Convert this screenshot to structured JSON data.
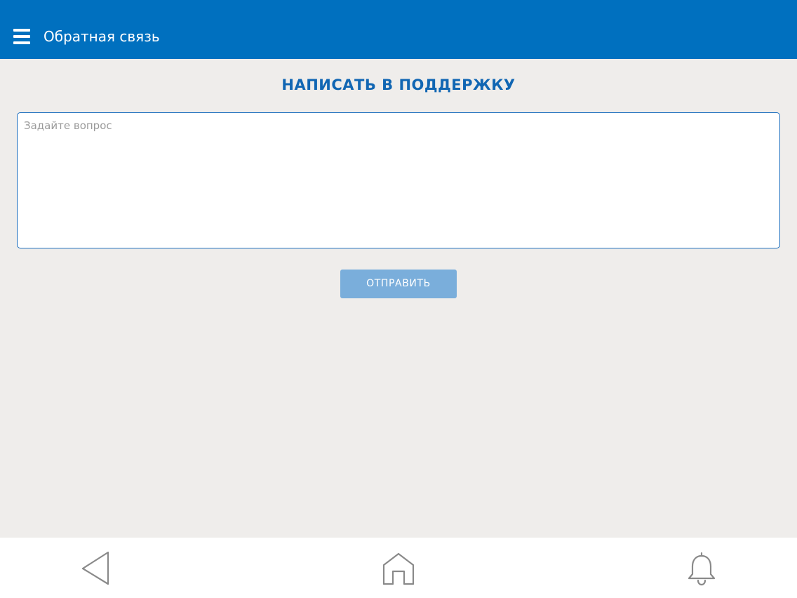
{
  "top_bar": {
    "menu_icon": "hamburger-menu-icon",
    "title": "Обратная связь",
    "background_color": "#0070bf"
  },
  "main": {
    "heading": "НАПИСАТЬ В ПОДДЕРЖКУ",
    "question_field": {
      "placeholder": "Задайте вопрос",
      "value": ""
    },
    "send_button_label": "ОТПРАВИТЬ",
    "accent_color": "#1166b3",
    "button_color": "#7aaedb"
  },
  "bottom_nav": {
    "items": [
      {
        "icon": "back-triangle-icon"
      },
      {
        "icon": "home-icon"
      },
      {
        "icon": "bell-icon"
      }
    ]
  }
}
